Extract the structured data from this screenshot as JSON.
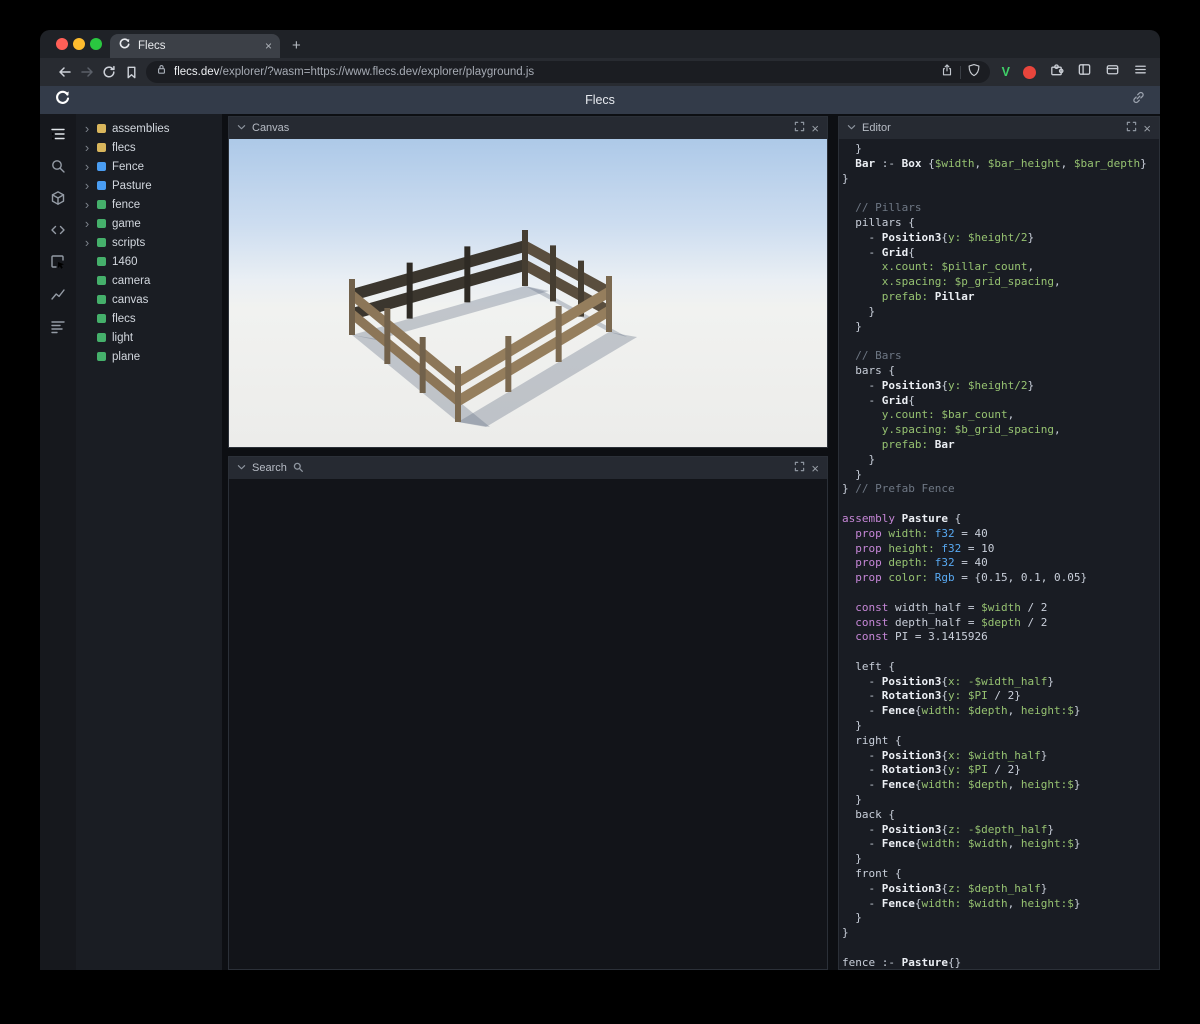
{
  "icons": {
    "close": "×",
    "plus": "+",
    "tree_arrow": "›"
  },
  "browser": {
    "tab": {
      "title": "Flecs"
    },
    "url": {
      "domain": "flecs.dev",
      "path": "/explorer/?wasm=https://www.flecs.dev/explorer/playground.js"
    },
    "traffic_lights": [
      "#ff5f57",
      "#febc2e",
      "#2ac840"
    ]
  },
  "app_header": {
    "title": "Flecs"
  },
  "tree": {
    "items": [
      {
        "label": "assemblies",
        "expandable": true,
        "dot_color": "#d9b65c"
      },
      {
        "label": "flecs",
        "expandable": true,
        "dot_color": "#d9b65c"
      },
      {
        "label": "Fence",
        "expandable": true,
        "dot_color": "#4a9df2"
      },
      {
        "label": "Pasture",
        "expandable": true,
        "dot_color": "#4a9df2"
      },
      {
        "label": "fence",
        "expandable": true,
        "dot_color": "#45b06b"
      },
      {
        "label": "game",
        "expandable": true,
        "dot_color": "#45b06b"
      },
      {
        "label": "scripts",
        "expandable": true,
        "dot_color": "#45b06b"
      },
      {
        "label": "1460",
        "expandable": false,
        "dot_color": "#45b06b"
      },
      {
        "label": "camera",
        "expandable": false,
        "dot_color": "#45b06b"
      },
      {
        "label": "canvas",
        "expandable": false,
        "dot_color": "#45b06b"
      },
      {
        "label": "flecs",
        "expandable": false,
        "dot_color": "#45b06b"
      },
      {
        "label": "light",
        "expandable": false,
        "dot_color": "#45b06b"
      },
      {
        "label": "plane",
        "expandable": false,
        "dot_color": "#45b06b"
      }
    ]
  },
  "panels": {
    "canvas": {
      "title": "Canvas"
    },
    "search": {
      "title": "Search"
    },
    "editor": {
      "title": "Editor",
      "code_lines": [
        [
          [
            "  }",
            "p"
          ]
        ],
        [
          [
            "  ",
            "p"
          ],
          [
            "Bar",
            "e"
          ],
          [
            " :- ",
            "p"
          ],
          [
            "Box",
            "e"
          ],
          [
            " {",
            "p"
          ],
          [
            "$width",
            "v"
          ],
          [
            ", ",
            "p"
          ],
          [
            "$bar_height",
            "v"
          ],
          [
            ", ",
            "p"
          ],
          [
            "$bar_depth",
            "v"
          ],
          [
            "}",
            "p"
          ]
        ],
        [
          [
            "}",
            "p"
          ]
        ],
        [],
        [
          [
            "  ",
            "p"
          ],
          [
            "// Pillars",
            "c"
          ]
        ],
        [
          [
            "  pillars {",
            "p"
          ]
        ],
        [
          [
            "    - ",
            "p"
          ],
          [
            "Position3",
            "e"
          ],
          [
            "{",
            "p"
          ],
          [
            "y: $height/2",
            "v"
          ],
          [
            "}",
            "p"
          ]
        ],
        [
          [
            "    - ",
            "p"
          ],
          [
            "Grid",
            "e"
          ],
          [
            "{",
            "p"
          ]
        ],
        [
          [
            "      ",
            "p"
          ],
          [
            "x.count:",
            "v"
          ],
          [
            " ",
            "p"
          ],
          [
            "$pillar_count",
            "v"
          ],
          [
            ",",
            "p"
          ]
        ],
        [
          [
            "      ",
            "p"
          ],
          [
            "x.spacing:",
            "v"
          ],
          [
            " ",
            "p"
          ],
          [
            "$p_grid_spacing",
            "v"
          ],
          [
            ",",
            "p"
          ]
        ],
        [
          [
            "      ",
            "p"
          ],
          [
            "prefab:",
            "v"
          ],
          [
            " ",
            "p"
          ],
          [
            "Pillar",
            "e"
          ]
        ],
        [
          [
            "    }",
            "p"
          ]
        ],
        [
          [
            "  }",
            "p"
          ]
        ],
        [],
        [
          [
            "  ",
            "p"
          ],
          [
            "// Bars",
            "c"
          ]
        ],
        [
          [
            "  bars {",
            "p"
          ]
        ],
        [
          [
            "    - ",
            "p"
          ],
          [
            "Position3",
            "e"
          ],
          [
            "{",
            "p"
          ],
          [
            "y: $height/2",
            "v"
          ],
          [
            "}",
            "p"
          ]
        ],
        [
          [
            "    - ",
            "p"
          ],
          [
            "Grid",
            "e"
          ],
          [
            "{",
            "p"
          ]
        ],
        [
          [
            "      ",
            "p"
          ],
          [
            "y.count:",
            "v"
          ],
          [
            " ",
            "p"
          ],
          [
            "$bar_count",
            "v"
          ],
          [
            ",",
            "p"
          ]
        ],
        [
          [
            "      ",
            "p"
          ],
          [
            "y.spacing:",
            "v"
          ],
          [
            " ",
            "p"
          ],
          [
            "$b_grid_spacing",
            "v"
          ],
          [
            ",",
            "p"
          ]
        ],
        [
          [
            "      ",
            "p"
          ],
          [
            "prefab:",
            "v"
          ],
          [
            " ",
            "p"
          ],
          [
            "Bar",
            "e"
          ]
        ],
        [
          [
            "    }",
            "p"
          ]
        ],
        [
          [
            "  }",
            "p"
          ]
        ],
        [
          [
            "} ",
            "p"
          ],
          [
            "// Prefab Fence",
            "c"
          ]
        ],
        [],
        [
          [
            "assembly",
            "k"
          ],
          [
            " ",
            "p"
          ],
          [
            "Pasture",
            "e"
          ],
          [
            " {",
            "p"
          ]
        ],
        [
          [
            "  ",
            "p"
          ],
          [
            "prop",
            "k"
          ],
          [
            " ",
            "p"
          ],
          [
            "width:",
            "v"
          ],
          [
            " ",
            "p"
          ],
          [
            "f32",
            "t"
          ],
          [
            " = 40",
            "p"
          ]
        ],
        [
          [
            "  ",
            "p"
          ],
          [
            "prop",
            "k"
          ],
          [
            " ",
            "p"
          ],
          [
            "height:",
            "v"
          ],
          [
            " ",
            "p"
          ],
          [
            "f32",
            "t"
          ],
          [
            " = 10",
            "p"
          ]
        ],
        [
          [
            "  ",
            "p"
          ],
          [
            "prop",
            "k"
          ],
          [
            " ",
            "p"
          ],
          [
            "depth:",
            "v"
          ],
          [
            " ",
            "p"
          ],
          [
            "f32",
            "t"
          ],
          [
            " = 40",
            "p"
          ]
        ],
        [
          [
            "  ",
            "p"
          ],
          [
            "prop",
            "k"
          ],
          [
            " ",
            "p"
          ],
          [
            "color:",
            "v"
          ],
          [
            " ",
            "p"
          ],
          [
            "Rgb",
            "t"
          ],
          [
            " = {0.15, 0.1, 0.05}",
            "p"
          ]
        ],
        [],
        [
          [
            "  ",
            "p"
          ],
          [
            "const",
            "k"
          ],
          [
            " width_half = ",
            "p"
          ],
          [
            "$width",
            "v"
          ],
          [
            " / 2",
            "p"
          ]
        ],
        [
          [
            "  ",
            "p"
          ],
          [
            "const",
            "k"
          ],
          [
            " depth_half = ",
            "p"
          ],
          [
            "$depth",
            "v"
          ],
          [
            " / 2",
            "p"
          ]
        ],
        [
          [
            "  ",
            "p"
          ],
          [
            "const",
            "k"
          ],
          [
            " PI = 3.1415926",
            "p"
          ]
        ],
        [],
        [
          [
            "  left {",
            "p"
          ]
        ],
        [
          [
            "    - ",
            "p"
          ],
          [
            "Position3",
            "e"
          ],
          [
            "{",
            "p"
          ],
          [
            "x: -$width_half",
            "v"
          ],
          [
            "}",
            "p"
          ]
        ],
        [
          [
            "    - ",
            "p"
          ],
          [
            "Rotation3",
            "e"
          ],
          [
            "{",
            "p"
          ],
          [
            "y: $PI",
            "v"
          ],
          [
            " / 2}",
            "p"
          ]
        ],
        [
          [
            "    - ",
            "p"
          ],
          [
            "Fence",
            "e"
          ],
          [
            "{",
            "p"
          ],
          [
            "width: $depth",
            "v"
          ],
          [
            ", ",
            "p"
          ],
          [
            "height:$",
            "v"
          ],
          [
            "}",
            "p"
          ]
        ],
        [
          [
            "  }",
            "p"
          ]
        ],
        [
          [
            "  right {",
            "p"
          ]
        ],
        [
          [
            "    - ",
            "p"
          ],
          [
            "Position3",
            "e"
          ],
          [
            "{",
            "p"
          ],
          [
            "x: $width_half",
            "v"
          ],
          [
            "}",
            "p"
          ]
        ],
        [
          [
            "    - ",
            "p"
          ],
          [
            "Rotation3",
            "e"
          ],
          [
            "{",
            "p"
          ],
          [
            "y: $PI",
            "v"
          ],
          [
            " / 2}",
            "p"
          ]
        ],
        [
          [
            "    - ",
            "p"
          ],
          [
            "Fence",
            "e"
          ],
          [
            "{",
            "p"
          ],
          [
            "width: $depth",
            "v"
          ],
          [
            ", ",
            "p"
          ],
          [
            "height:$",
            "v"
          ],
          [
            "}",
            "p"
          ]
        ],
        [
          [
            "  }",
            "p"
          ]
        ],
        [
          [
            "  back {",
            "p"
          ]
        ],
        [
          [
            "    - ",
            "p"
          ],
          [
            "Position3",
            "e"
          ],
          [
            "{",
            "p"
          ],
          [
            "z: -$depth_half",
            "v"
          ],
          [
            "}",
            "p"
          ]
        ],
        [
          [
            "    - ",
            "p"
          ],
          [
            "Fence",
            "e"
          ],
          [
            "{",
            "p"
          ],
          [
            "width: $width",
            "v"
          ],
          [
            ", ",
            "p"
          ],
          [
            "height:$",
            "v"
          ],
          [
            "}",
            "p"
          ]
        ],
        [
          [
            "  }",
            "p"
          ]
        ],
        [
          [
            "  front {",
            "p"
          ]
        ],
        [
          [
            "    - ",
            "p"
          ],
          [
            "Position3",
            "e"
          ],
          [
            "{",
            "p"
          ],
          [
            "z: $depth_half",
            "v"
          ],
          [
            "}",
            "p"
          ]
        ],
        [
          [
            "    - ",
            "p"
          ],
          [
            "Fence",
            "e"
          ],
          [
            "{",
            "p"
          ],
          [
            "width: $width",
            "v"
          ],
          [
            ", ",
            "p"
          ],
          [
            "height:$",
            "v"
          ],
          [
            "}",
            "p"
          ]
        ],
        [
          [
            "  }",
            "p"
          ]
        ],
        [
          [
            "}",
            "p"
          ]
        ],
        [],
        [
          [
            "fence :- ",
            "p"
          ],
          [
            "Pasture",
            "e"
          ],
          [
            "{}",
            "p"
          ]
        ]
      ]
    }
  }
}
